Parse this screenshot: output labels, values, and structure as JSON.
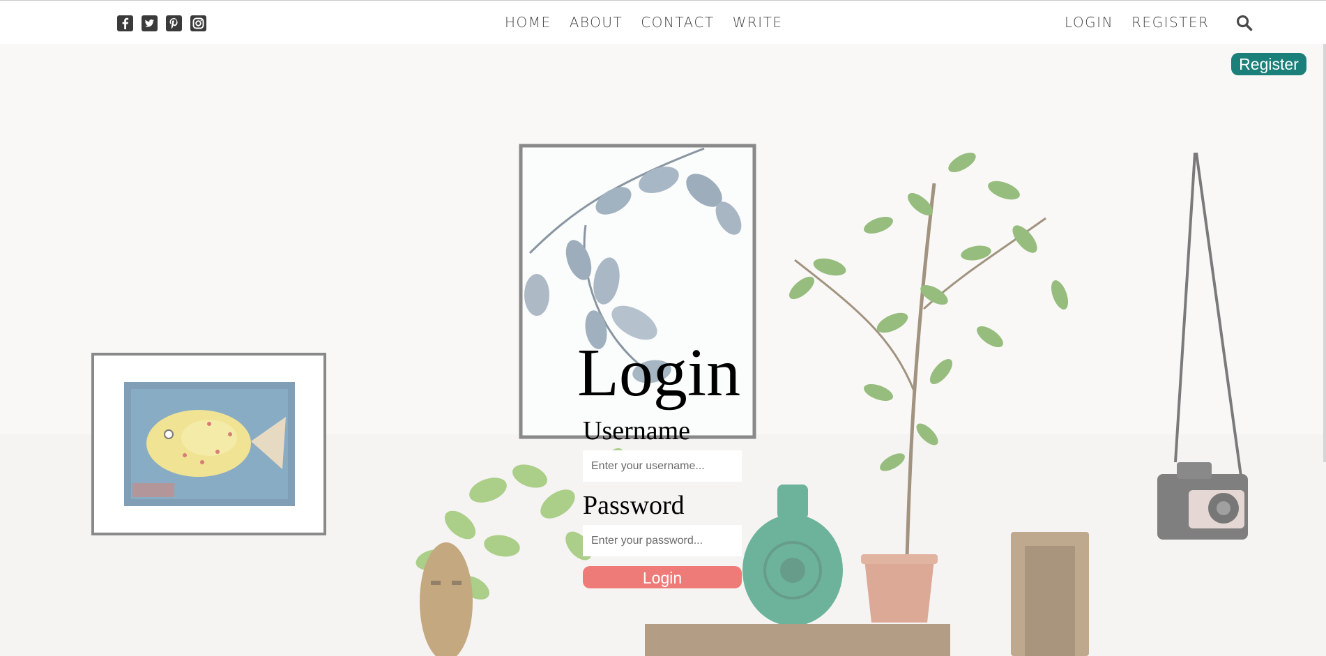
{
  "social": [
    {
      "icon": "facebook-square-icon"
    },
    {
      "icon": "twitter-square-icon"
    },
    {
      "icon": "pinterest-square-icon"
    },
    {
      "icon": "instagram-square-icon"
    }
  ],
  "nav": {
    "center": [
      "HOME",
      "ABOUT",
      "CONTACT",
      "WRITE"
    ],
    "right": [
      "LOGIN",
      "REGISTER"
    ],
    "search_icon": "search-icon"
  },
  "register_button": "Register",
  "login": {
    "title": "Login",
    "username_label": "Username",
    "username_placeholder": "Enter your username...",
    "password_label": "Password",
    "password_placeholder": "Enter your password...",
    "submit_label": "Login"
  },
  "colors": {
    "register_button": "#1a8079",
    "login_button": "#ee7b78",
    "nav_text": "#444444"
  }
}
